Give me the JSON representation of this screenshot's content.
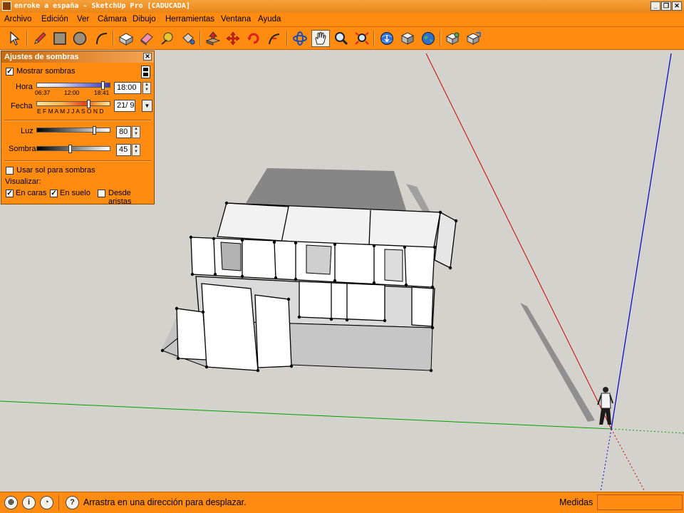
{
  "window": {
    "title": "enroke a españa - SketchUp Pro [CADUCADA]",
    "controls": {
      "minimize": "_",
      "restore": "❐",
      "close": "✕"
    }
  },
  "menu": [
    "Archivo",
    "Edición",
    "Ver",
    "Cámara",
    "Dibujo",
    "Herramientas",
    "Ventana",
    "Ayuda"
  ],
  "toolbar": {
    "tools": [
      "select-tool",
      "pencil-tool",
      "rectangle-tool",
      "circle-tool",
      "arc-tool",
      "make-component-tool",
      "eraser-tool",
      "tape-measure-tool",
      "paint-bucket-tool",
      "push-pull-tool",
      "move-tool",
      "rotate-tool",
      "follow-me-tool",
      "orbit-tool",
      "pan-tool",
      "zoom-tool",
      "zoom-extents-tool",
      "get-models-tool",
      "share-model-tool",
      "google-earth-tool",
      "component-tool",
      "share-component-tool"
    ],
    "active_tool": "pan-tool"
  },
  "shadow_panel": {
    "title": "Ajustes de sombras",
    "close": "✕",
    "show_shadows_label": "Mostrar sombras",
    "show_shadows": true,
    "time": {
      "label": "Hora",
      "start": "06:37",
      "mid": "12:00",
      "end": "18:41",
      "value": "18:00",
      "fraction": 0.93
    },
    "date": {
      "label": "Fecha",
      "months": "E F M A M J  J  A S O N D",
      "value": "21/ 9",
      "fraction": 0.72
    },
    "light": {
      "label": "Luz",
      "value": "80",
      "fraction": 0.8
    },
    "dark": {
      "label": "Sombra",
      "value": "45",
      "fraction": 0.45
    },
    "use_sun_label": "Usar sol para sombras",
    "use_sun": false,
    "display_label": "Visualizar:",
    "on_faces_label": "En caras",
    "on_faces": true,
    "on_ground_label": "En suelo",
    "on_ground": true,
    "from_edges_label": "Desde aristas",
    "from_edges": false
  },
  "status": {
    "message": "Arrastra en una dirección para desplazar.",
    "measurements_label": "Medidas",
    "measurements_value": ""
  },
  "colors": {
    "ui_orange": "#ff8c10",
    "viewport_bg": "#d4d2cd",
    "axis_red": "#cc0000",
    "axis_green": "#00a000",
    "axis_blue": "#0000cc"
  }
}
